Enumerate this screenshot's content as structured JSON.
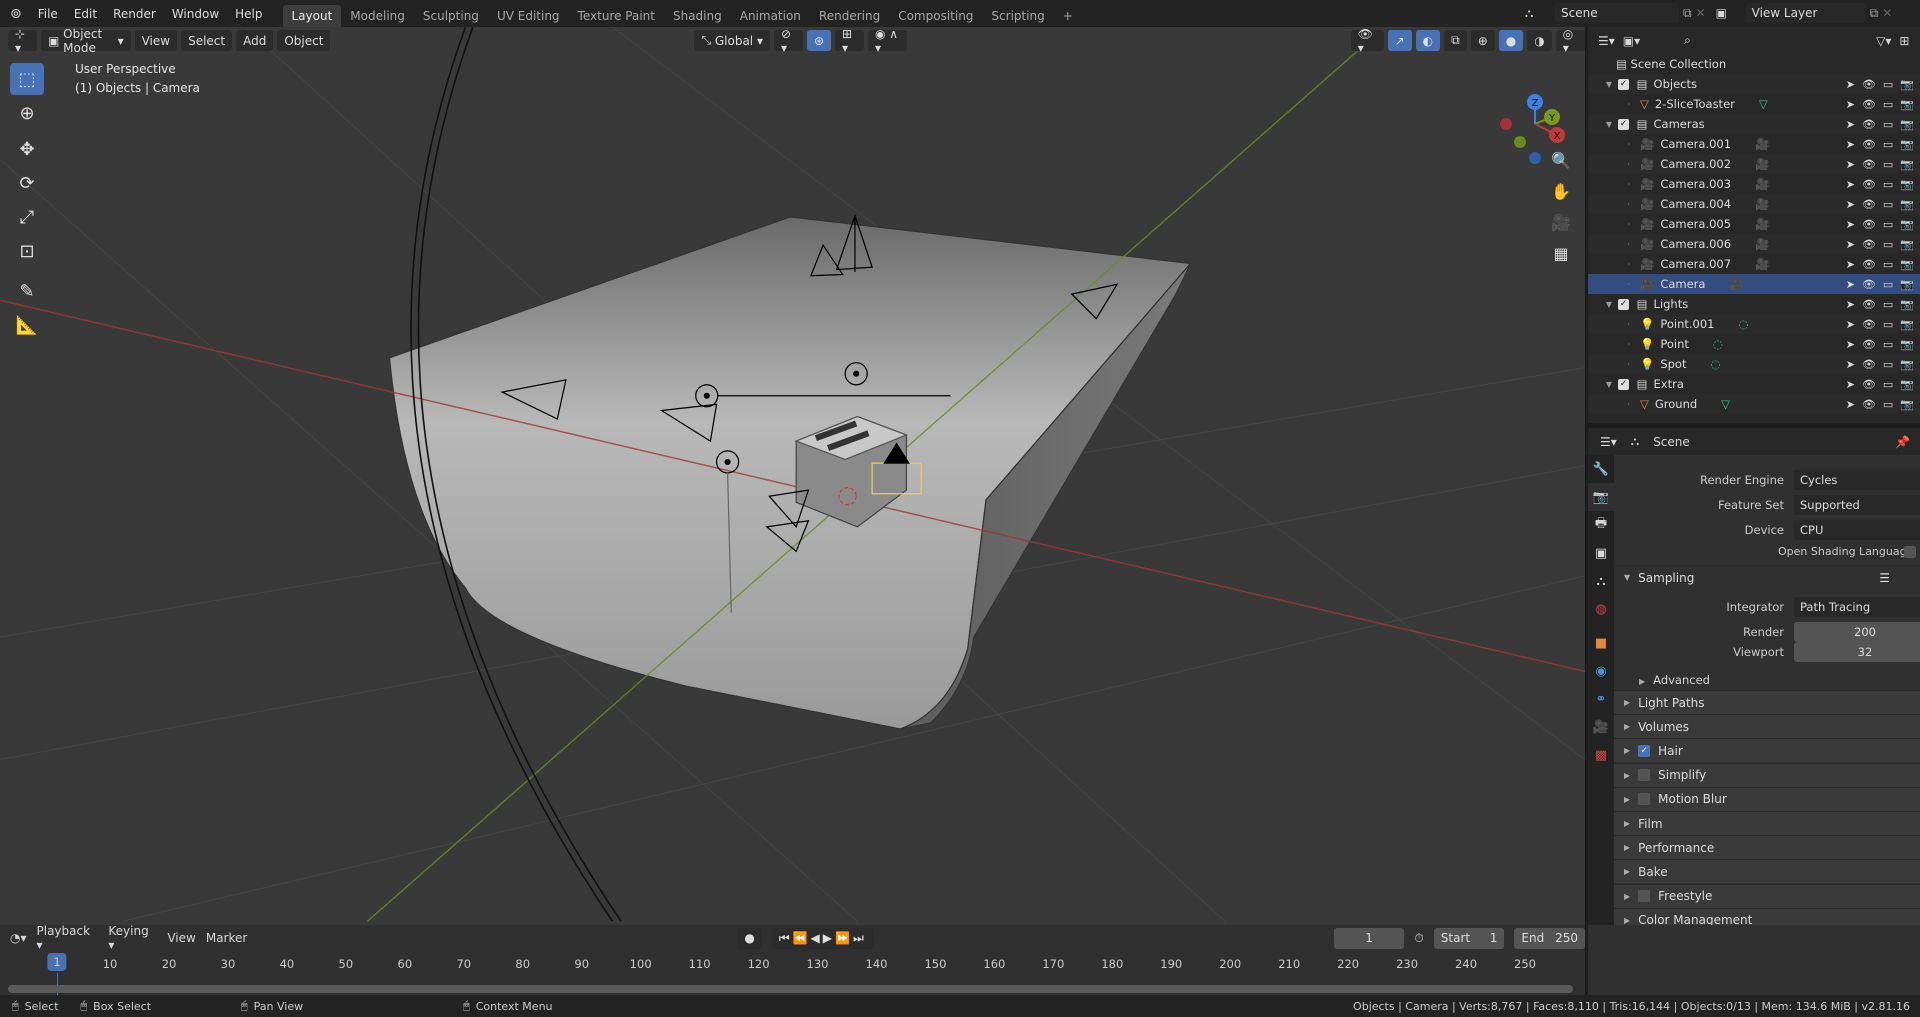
{
  "topbar": {
    "menus": [
      "File",
      "Edit",
      "Render",
      "Window",
      "Help"
    ],
    "workspaces": [
      "Layout",
      "Modeling",
      "Sculpting",
      "UV Editing",
      "Texture Paint",
      "Shading",
      "Animation",
      "Rendering",
      "Compositing",
      "Scripting"
    ],
    "add_tab": "+",
    "scene": "Scene",
    "view_layer": "View Layer"
  },
  "viewport": {
    "mode": "Object Mode",
    "menus": [
      "View",
      "Select",
      "Add",
      "Object"
    ],
    "orientation": "Global",
    "overlay_title": "User Perspective",
    "overlay_sub": "(1) Objects | Camera",
    "gizmo": {
      "z": "Z",
      "y": "Y",
      "x": "X"
    }
  },
  "outliner": {
    "root": "Scene Collection",
    "rows": [
      {
        "label": "Objects",
        "type": "collection",
        "indent": 1
      },
      {
        "label": "2-SliceToaster",
        "type": "mesh",
        "indent": 2
      },
      {
        "label": "Cameras",
        "type": "collection",
        "indent": 1
      },
      {
        "label": "Camera.001",
        "type": "camera",
        "indent": 2
      },
      {
        "label": "Camera.002",
        "type": "camera",
        "indent": 2
      },
      {
        "label": "Camera.003",
        "type": "camera",
        "indent": 2
      },
      {
        "label": "Camera.004",
        "type": "camera",
        "indent": 2
      },
      {
        "label": "Camera.005",
        "type": "camera",
        "indent": 2
      },
      {
        "label": "Camera.006",
        "type": "camera",
        "indent": 2
      },
      {
        "label": "Camera.007",
        "type": "camera",
        "indent": 2
      },
      {
        "label": "Camera",
        "type": "camera",
        "indent": 2
      },
      {
        "label": "Lights",
        "type": "collection",
        "indent": 1
      },
      {
        "label": "Point.001",
        "type": "light",
        "indent": 2
      },
      {
        "label": "Point",
        "type": "light",
        "indent": 2
      },
      {
        "label": "Spot",
        "type": "light",
        "indent": 2
      },
      {
        "label": "Extra",
        "type": "collection",
        "indent": 1
      },
      {
        "label": "Ground",
        "type": "mesh",
        "indent": 2
      }
    ]
  },
  "properties": {
    "context": "Scene",
    "render_engine_label": "Render Engine",
    "render_engine": "Cycles",
    "feature_set_label": "Feature Set",
    "feature_set": "Supported",
    "device_label": "Device",
    "device": "CPU",
    "osl_label": "Open Shading Language",
    "sampling": "Sampling",
    "integrator_label": "Integrator",
    "integrator": "Path Tracing",
    "render_label": "Render",
    "render_samples": "200",
    "viewport_label": "Viewport",
    "viewport_samples": "32",
    "advanced": "Advanced",
    "panels": [
      {
        "label": "Light Paths",
        "check": null
      },
      {
        "label": "Volumes",
        "check": null
      },
      {
        "label": "Hair",
        "check": true
      },
      {
        "label": "Simplify",
        "check": false
      },
      {
        "label": "Motion Blur",
        "check": false
      },
      {
        "label": "Film",
        "check": null
      },
      {
        "label": "Performance",
        "check": null
      },
      {
        "label": "Bake",
        "check": null
      },
      {
        "label": "Freestyle",
        "check": false
      },
      {
        "label": "Color Management",
        "check": null
      }
    ]
  },
  "timeline": {
    "menus": [
      "Playback",
      "Keying",
      "View",
      "Marker"
    ],
    "current_frame": "1",
    "start_label": "Start",
    "start": "1",
    "end_label": "End",
    "end": "250",
    "ticks": [
      "1",
      "10",
      "20",
      "30",
      "40",
      "50",
      "60",
      "70",
      "80",
      "90",
      "100",
      "110",
      "120",
      "130",
      "140",
      "150",
      "160",
      "170",
      "180",
      "190",
      "200",
      "210",
      "220",
      "230",
      "240",
      "250"
    ]
  },
  "status": {
    "select": "Select",
    "box_select": "Box Select",
    "pan_view": "Pan View",
    "context_menu": "Context Menu",
    "stats": "Objects | Camera | Verts:8,767 | Faces:8,110 | Tris:16,144 | Objects:0/13 | Mem: 134.6 MiB | v2.81.16"
  },
  "colors": {
    "accent": "#4772b3",
    "x_axis": "#c0393b",
    "y_axis": "#7a9a1f",
    "z_axis": "#3b83e0",
    "camera_icon": "#e3893a",
    "data_icon": "#3ec58a"
  }
}
